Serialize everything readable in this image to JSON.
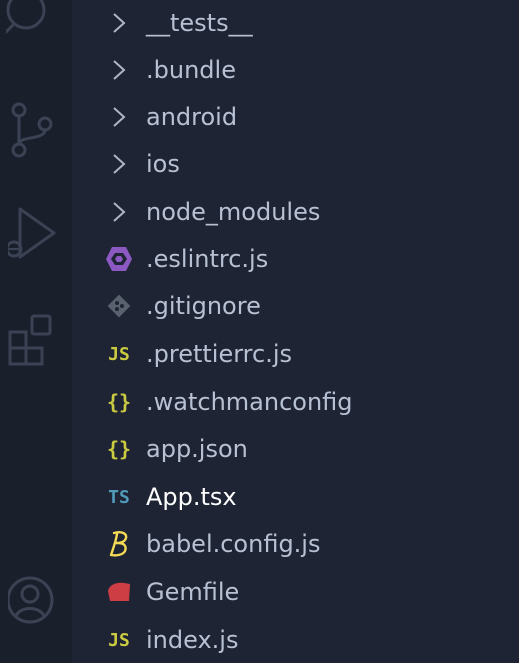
{
  "activity_bar": {
    "icons": [
      "search-icon",
      "source-control-icon",
      "run-debug-icon",
      "extensions-icon",
      "account-icon"
    ]
  },
  "explorer": {
    "items": [
      {
        "label": "__tests__",
        "type": "folder",
        "icon": "chevron-right-icon"
      },
      {
        "label": ".bundle",
        "type": "folder",
        "icon": "chevron-right-icon"
      },
      {
        "label": "android",
        "type": "folder",
        "icon": "chevron-right-icon"
      },
      {
        "label": "ios",
        "type": "folder",
        "icon": "chevron-right-icon"
      },
      {
        "label": "node_modules",
        "type": "folder",
        "icon": "chevron-right-icon"
      },
      {
        "label": ".eslintrc.js",
        "type": "file",
        "icon": "eslint-icon"
      },
      {
        "label": ".gitignore",
        "type": "file",
        "icon": "git-icon"
      },
      {
        "label": ".prettierrc.js",
        "type": "file",
        "icon": "javascript-icon",
        "glyph": "JS"
      },
      {
        "label": ".watchmanconfig",
        "type": "file",
        "icon": "json-icon",
        "glyph": "{}"
      },
      {
        "label": "app.json",
        "type": "file",
        "icon": "json-icon",
        "glyph": "{}"
      },
      {
        "label": "App.tsx",
        "type": "file",
        "icon": "typescript-icon",
        "glyph": "TS",
        "active": true
      },
      {
        "label": "babel.config.js",
        "type": "file",
        "icon": "babel-icon"
      },
      {
        "label": "Gemfile",
        "type": "file",
        "icon": "ruby-icon"
      },
      {
        "label": "index.js",
        "type": "file",
        "icon": "javascript-icon",
        "glyph": "JS"
      }
    ]
  },
  "colors": {
    "activity_bar_bg": "#1a1f2c",
    "explorer_bg": "#1e2433",
    "text": "#b8c1d3",
    "active_text": "#ffffff",
    "chevron": "#aeb6c6",
    "js_yellow": "#cbcb41",
    "ts_blue": "#519aba",
    "eslint_purple": "#8c59c2",
    "git_gray": "#59616f",
    "ruby_red": "#cc3e44",
    "babel_yellow": "#f5da55"
  }
}
